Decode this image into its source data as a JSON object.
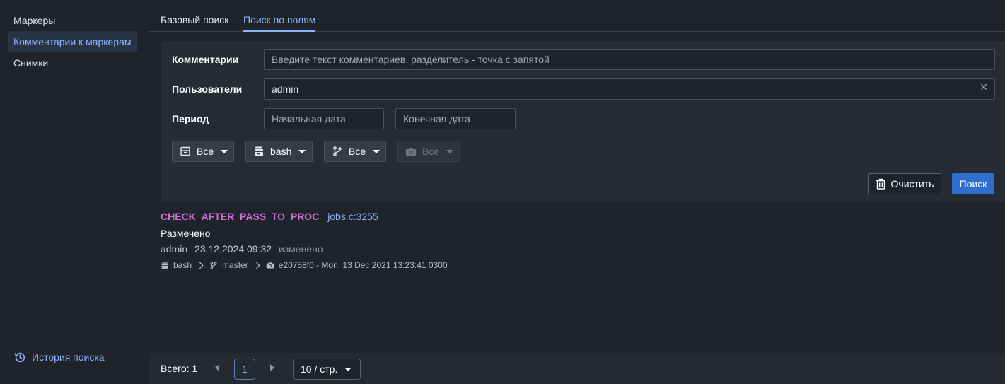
{
  "sidebar": {
    "items": [
      {
        "label": "Маркеры"
      },
      {
        "label": "Комментарии к маркерам"
      },
      {
        "label": "Снимки"
      }
    ],
    "history_label": "История поиска"
  },
  "tabs": [
    {
      "label": "Базовый поиск"
    },
    {
      "label": "Поиск по полям"
    }
  ],
  "form": {
    "comments_label": "Комментарии",
    "comments_placeholder": "Введите текст комментариев, разделитель - точка с запятой",
    "users_label": "Пользователи",
    "users_value": "admin",
    "period_label": "Период",
    "start_placeholder": "Начальная дата",
    "end_placeholder": "Конечная дата",
    "filters": [
      {
        "icon": "archive-icon",
        "value": "Все"
      },
      {
        "icon": "database-icon",
        "value": "bash"
      },
      {
        "icon": "branch-icon",
        "value": "Все"
      },
      {
        "icon": "camera-icon",
        "value": "Все",
        "disabled": true
      }
    ],
    "clear_label": "Очистить",
    "search_label": "Поиск"
  },
  "result": {
    "marker": "CHECK_AFTER_PASS_TO_PROC",
    "file": "jobs.c:3255",
    "status": "Размечено",
    "user": "admin",
    "date": "23.12.2024 09:32",
    "changed": "изменено",
    "project": "bash",
    "branch": "master",
    "snapshot": "e20758f0 - Mon, 13 Dec 2021 13:23:41 0300"
  },
  "pagination": {
    "total": "Всего: 1",
    "current_page": "1",
    "page_size": "10 / стр."
  },
  "colors": {
    "accent": "#8ab4f8",
    "marker": "#d06fd6",
    "primary_button": "#2f6fd0"
  }
}
